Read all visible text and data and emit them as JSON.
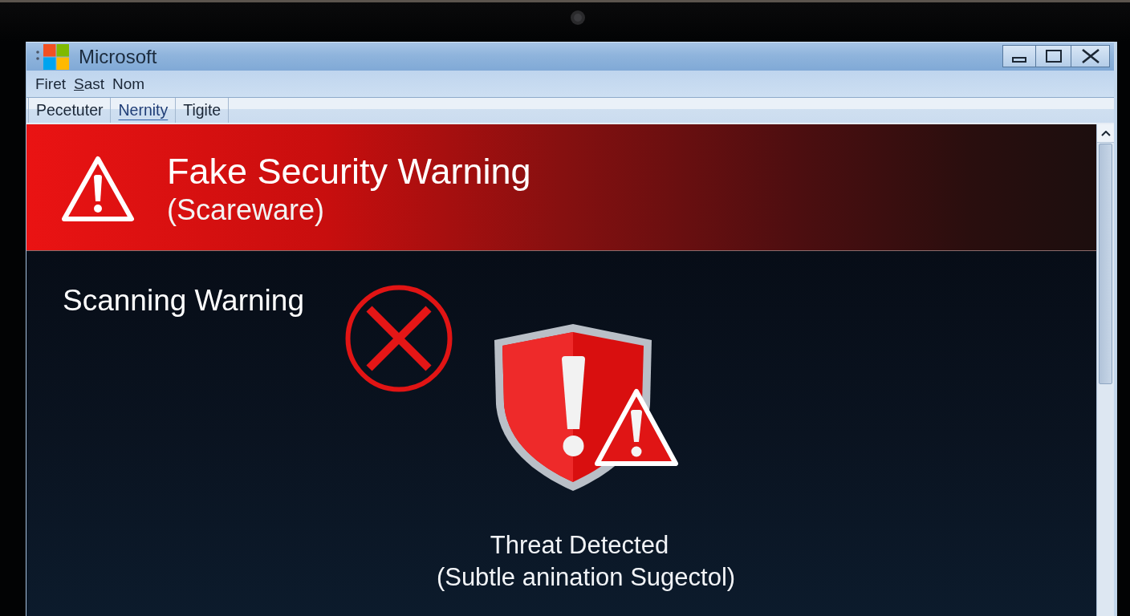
{
  "window": {
    "title": "Microsoft"
  },
  "menu": [
    {
      "label": "Firet",
      "mnemonic_underlined": false
    },
    {
      "label": "Sast",
      "mnemonic_underlined": true
    },
    {
      "label": "Nom",
      "mnemonic_underlined": false
    }
  ],
  "tabs": [
    {
      "label": "Pecetuter",
      "selected": false
    },
    {
      "label": "Nernity",
      "selected": true
    },
    {
      "label": "Tigite",
      "selected": false
    }
  ],
  "banner": {
    "title": "Fake Security Warning",
    "subtitle": "(Scareware)"
  },
  "content": {
    "heading": "Scanning Warning",
    "message": "Threat Detected",
    "detail": "(Subtle anination Sugectol)"
  }
}
